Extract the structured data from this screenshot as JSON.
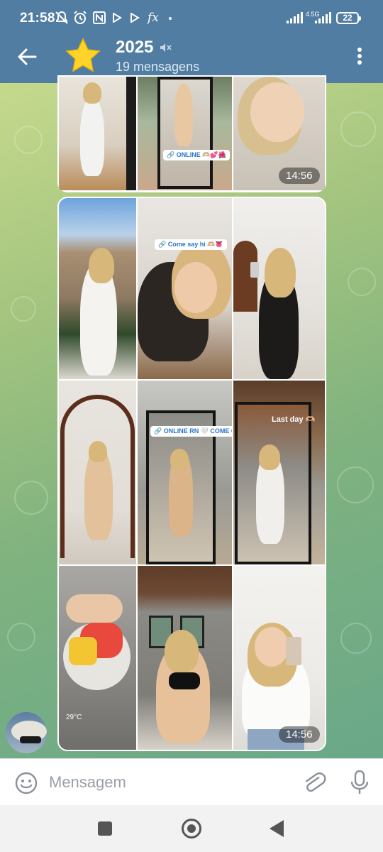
{
  "status_bar": {
    "time": "21:58",
    "network": "4.5G",
    "battery": "22",
    "icons": [
      "notifications-off-icon",
      "alarm-icon",
      "nfc-icon",
      "play-icon",
      "play-icon",
      "fx-icon",
      "dot-icon",
      "signal-icon",
      "signal-icon"
    ]
  },
  "header": {
    "title": "2025",
    "subtitle": "19 mensagens",
    "avatar_icon": "star-icon",
    "muted_icon": "mute-icon",
    "menu_icon": "more-vert-icon",
    "back_icon": "arrow-back-icon",
    "color": "#527da3"
  },
  "album_top": {
    "time": "14:56",
    "photos": [
      {
        "sticker": ""
      },
      {
        "sticker": "🔗 ONLINE 🫶🏼💕🌺"
      },
      {
        "sticker": ""
      }
    ]
  },
  "album_main": {
    "time": "14:56",
    "photos": [
      {
        "sticker": ""
      },
      {
        "sticker": "🔗 Come say hi 🫶🏼👅"
      },
      {
        "sticker": ""
      },
      {
        "sticker": ""
      },
      {
        "sticker": "🔗 ONLINE RN 🤍 COME CHAT!"
      },
      {
        "sticker": "Last day 🫶🏼"
      },
      {
        "sticker": "29°C"
      },
      {
        "sticker": ""
      },
      {
        "sticker": ""
      }
    ]
  },
  "input": {
    "placeholder": "Mensagem",
    "value": ""
  },
  "nav": {
    "recents_icon": "square-icon",
    "home_icon": "circle-icon",
    "back_icon": "triangle-back-icon"
  }
}
